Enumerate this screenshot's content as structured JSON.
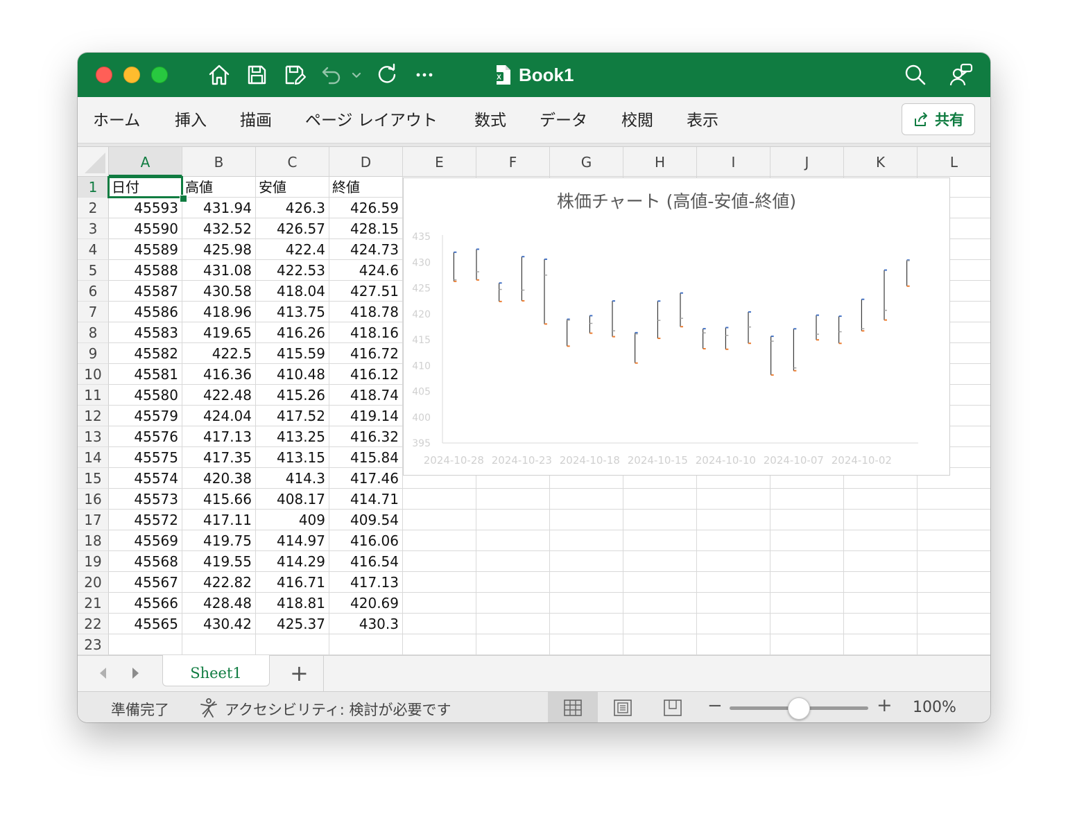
{
  "window": {
    "title": "Book1",
    "file_icon_text": "X",
    "toolbar_icons": [
      "home-icon",
      "save-icon",
      "save-as-icon",
      "undo-icon",
      "chevron-down-icon",
      "redo-icon",
      "more-icon"
    ],
    "right_icons": [
      "search-icon",
      "people-icon"
    ]
  },
  "ribbon": {
    "tabs": [
      "ホーム",
      "挿入",
      "描画",
      "ページ レイアウト",
      "数式",
      "データ",
      "校閲",
      "表示"
    ],
    "share_label": "共有"
  },
  "grid": {
    "columns": [
      "A",
      "B",
      "C",
      "D",
      "E",
      "F",
      "G",
      "H",
      "I",
      "J",
      "K",
      "L"
    ],
    "selected_column": "A",
    "row_numbers": [
      "1",
      "2",
      "3",
      "4",
      "5",
      "6",
      "7",
      "8",
      "9",
      "10",
      "11",
      "12",
      "13",
      "14",
      "15",
      "16",
      "17",
      "18",
      "19",
      "20",
      "21",
      "22",
      "23"
    ],
    "headers": [
      "日付",
      "高値",
      "安値",
      "終値"
    ],
    "rows": [
      [
        "45593",
        "431.94",
        "426.3",
        "426.59"
      ],
      [
        "45590",
        "432.52",
        "426.57",
        "428.15"
      ],
      [
        "45589",
        "425.98",
        "422.4",
        "424.73"
      ],
      [
        "45588",
        "431.08",
        "422.53",
        "424.6"
      ],
      [
        "45587",
        "430.58",
        "418.04",
        "427.51"
      ],
      [
        "45586",
        "418.96",
        "413.75",
        "418.78"
      ],
      [
        "45583",
        "419.65",
        "416.26",
        "418.16"
      ],
      [
        "45582",
        "422.5",
        "415.59",
        "416.72"
      ],
      [
        "45581",
        "416.36",
        "410.48",
        "416.12"
      ],
      [
        "45580",
        "422.48",
        "415.26",
        "418.74"
      ],
      [
        "45579",
        "424.04",
        "417.52",
        "419.14"
      ],
      [
        "45576",
        "417.13",
        "413.25",
        "416.32"
      ],
      [
        "45575",
        "417.35",
        "413.15",
        "415.84"
      ],
      [
        "45574",
        "420.38",
        "414.3",
        "417.46"
      ],
      [
        "45573",
        "415.66",
        "408.17",
        "414.71"
      ],
      [
        "45572",
        "417.11",
        "409",
        "409.54"
      ],
      [
        "45569",
        "419.75",
        "414.97",
        "416.06"
      ],
      [
        "45568",
        "419.55",
        "414.29",
        "416.54"
      ],
      [
        "45567",
        "422.82",
        "416.71",
        "417.13"
      ],
      [
        "45566",
        "428.48",
        "418.81",
        "420.69"
      ],
      [
        "45565",
        "430.42",
        "425.37",
        "430.3"
      ]
    ]
  },
  "chart_data": {
    "type": "stock-hlc",
    "title": "株価チャート (高値-安値-終値)",
    "ylim": [
      395,
      435
    ],
    "yticks": [
      "435",
      "430",
      "425",
      "420",
      "415",
      "410",
      "405",
      "400",
      "395"
    ],
    "xtick_labels": [
      "2024-10-28",
      "2024-10-23",
      "2024-10-18",
      "2024-10-15",
      "2024-10-10",
      "2024-10-07",
      "2024-10-02"
    ],
    "x": [
      "2024-10-28",
      "2024-10-25",
      "2024-10-24",
      "2024-10-23",
      "2024-10-22",
      "2024-10-21",
      "2024-10-18",
      "2024-10-17",
      "2024-10-16",
      "2024-10-15",
      "2024-10-14",
      "2024-10-11",
      "2024-10-10",
      "2024-10-09",
      "2024-10-08",
      "2024-10-07",
      "2024-10-04",
      "2024-10-03",
      "2024-10-02",
      "2024-10-01",
      "2024-09-30"
    ],
    "series": [
      {
        "name": "高値",
        "color": "#4472c4",
        "values": [
          431.94,
          432.52,
          425.98,
          431.08,
          430.58,
          418.96,
          419.65,
          422.5,
          416.36,
          422.48,
          424.04,
          417.13,
          417.35,
          420.38,
          415.66,
          417.11,
          419.75,
          419.55,
          422.82,
          428.48,
          430.42
        ]
      },
      {
        "name": "安値",
        "color": "#ed7d31",
        "values": [
          426.3,
          426.57,
          422.4,
          422.53,
          418.04,
          413.75,
          416.26,
          415.59,
          410.48,
          415.26,
          417.52,
          413.25,
          413.15,
          414.3,
          408.17,
          409,
          414.97,
          414.29,
          416.71,
          418.81,
          425.37
        ]
      },
      {
        "name": "終値",
        "color": "#a5a5a5",
        "values": [
          426.59,
          428.15,
          424.73,
          424.6,
          427.51,
          418.78,
          418.16,
          416.72,
          416.12,
          418.74,
          419.14,
          416.32,
          415.84,
          417.46,
          414.71,
          409.54,
          416.06,
          416.54,
          417.13,
          420.69,
          430.3
        ]
      }
    ],
    "legend": "none",
    "grid": false
  },
  "sheet_tabs": {
    "active": "Sheet1",
    "add_label": "+"
  },
  "status": {
    "ready": "準備完了",
    "accessibility": "アクセシビリティ: 検討が必要です",
    "zoom_minus": "−",
    "zoom_plus": "+",
    "zoom_level": "100%",
    "zoom_fraction": 0.5
  }
}
